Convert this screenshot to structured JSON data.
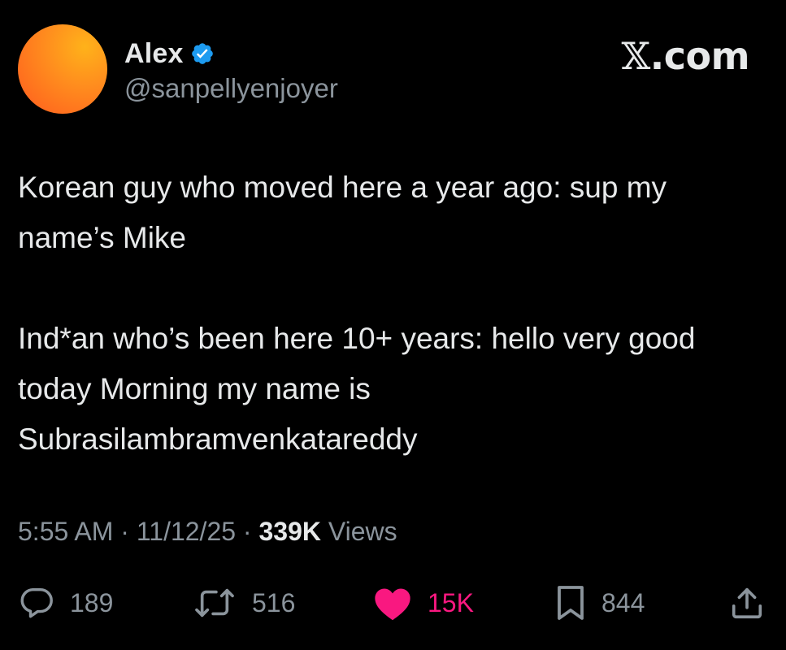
{
  "author": {
    "display_name": "Alex",
    "handle": "@sanpellyenjoyer",
    "verified": true,
    "avatar_colors": [
      "#ffb21a",
      "#ff5a1f"
    ]
  },
  "brand": {
    "logo_text": ".com",
    "logo_mark": "𝕏"
  },
  "tweet": {
    "paragraph_1": "Korean guy who moved here a year ago: sup my name’s Mike",
    "paragraph_2": "Ind*an who’s been here 10+ years: hello very good today Morning my name is Subrasilambramvenkatareddy"
  },
  "meta": {
    "time": "5:55 AM",
    "separator": "·",
    "date": "11/12/25",
    "views_count": "339K",
    "views_label": "Views"
  },
  "actions": {
    "replies": "189",
    "reposts": "516",
    "likes": "15K",
    "bookmarks": "844",
    "share_icon": "share-icon"
  },
  "colors": {
    "background": "#000000",
    "text_primary": "#e7e9ea",
    "text_secondary": "#8b949c",
    "verified_blue": "#1d9bf0",
    "like_pink": "#f91880"
  }
}
